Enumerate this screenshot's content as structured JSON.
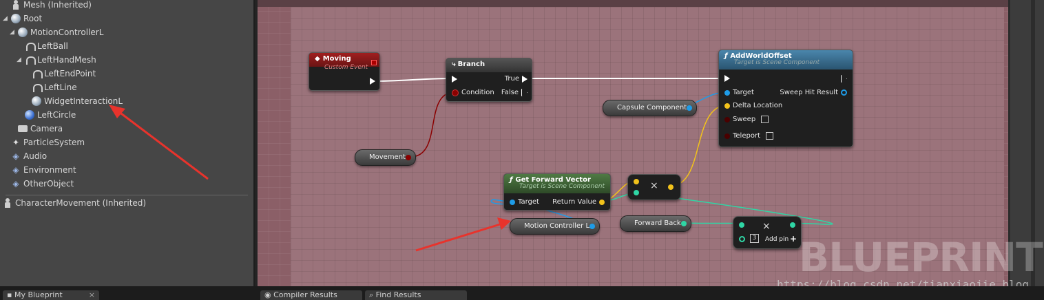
{
  "components": [
    {
      "label": "Mesh (Inherited)",
      "icon": "person-icon",
      "indent": 0,
      "arrow": ""
    },
    {
      "label": "Root",
      "icon": "sphere-icon",
      "indent": 0,
      "arrow": "▲"
    },
    {
      "label": "MotionControllerL",
      "icon": "sphere-icon",
      "indent": 1,
      "arrow": "▲"
    },
    {
      "label": "LeftBall",
      "icon": "bone-icon",
      "indent": 2,
      "arrow": ""
    },
    {
      "label": "LeftHandMesh",
      "icon": "bone-icon",
      "indent": 2,
      "arrow": "▲"
    },
    {
      "label": "LeftEndPoint",
      "icon": "bone-icon",
      "indent": 3,
      "arrow": ""
    },
    {
      "label": "LeftLine",
      "icon": "bone-icon",
      "indent": 3,
      "arrow": ""
    },
    {
      "label": "WidgetInteractionL",
      "icon": "sphere-icon",
      "indent": 3,
      "arrow": ""
    },
    {
      "label": "LeftCircle",
      "icon": "blue-sphere-icon",
      "indent": 2,
      "arrow": ""
    },
    {
      "label": "Camera",
      "icon": "camera-icon",
      "indent": 1,
      "arrow": ""
    },
    {
      "label": "ParticleSystem",
      "icon": "particle-icon",
      "indent": 0,
      "arrow": ""
    },
    {
      "label": "Audio",
      "icon": "audio-icon",
      "indent": 0,
      "arrow": ""
    },
    {
      "label": "Environment",
      "icon": "audio-icon",
      "indent": 0,
      "arrow": ""
    },
    {
      "label": "OtherObject",
      "icon": "audio-icon",
      "indent": 0,
      "arrow": ""
    }
  ],
  "inherited_component": "CharacterMovement (Inherited)",
  "tabs": {
    "my_blueprint": "My Blueprint",
    "close": "×",
    "compiler_results": "Compiler Results",
    "find_results": "Find Results"
  },
  "nodes": {
    "moving": {
      "title": "Moving",
      "subtitle": "Custom Event"
    },
    "branch": {
      "title": "Branch",
      "true": "True",
      "condition": "Condition",
      "false": "False"
    },
    "add_world_offset": {
      "title": "AddWorldOffset",
      "subtitle": "Target is Scene Component",
      "target": "Target",
      "delta": "Delta Location",
      "sweep": "Sweep",
      "teleport": "Teleport",
      "sweep_hit": "Sweep Hit Result"
    },
    "get_forward_vector": {
      "title": "Get Forward Vector",
      "subtitle": "Target is Scene Component",
      "target": "Target",
      "return_value": "Return Value"
    },
    "multiply": {
      "symbol": "×"
    },
    "make_vector": {
      "symbol": "×",
      "count": "3",
      "add_pin": "Add pin",
      "plus": "+"
    }
  },
  "variables": {
    "capsule": "Capsule Component",
    "movement": "Movement",
    "motion_controller": "Motion Controller L",
    "forward_back": "Forward Back"
  },
  "watermark": "BLUEPRINT",
  "credit": "https://blog.csdn.net/tianxiaojie_blog",
  "colors": {
    "graph_bg": "#9b737b",
    "event_head": "#8c1d1d",
    "function_head": "#3a6b8c",
    "pure_head": "#3f5f36",
    "object_pin": "#1e9ce8",
    "vector_pin": "#f2c21b",
    "float_pin": "#2fd6a5",
    "bool_pin": "#8b0000",
    "annotation": "#e8332c"
  }
}
